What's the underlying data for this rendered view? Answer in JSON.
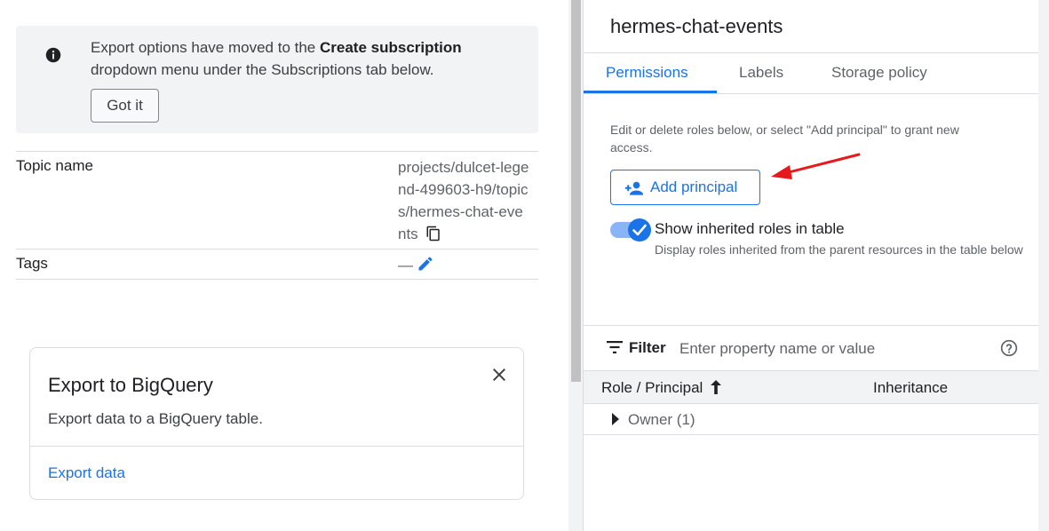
{
  "banner": {
    "text_before": "Export options have moved to the ",
    "text_bold": "Create subscription",
    "text_after": " dropdown menu under the Subscriptions tab below.",
    "button_label": "Got it",
    "icon": "info-icon"
  },
  "properties": [
    {
      "label": "Topic name",
      "value": "projects/dulcet-legend-499603-h9/topics/hermes-chat-events",
      "action_icon": "copy-icon"
    },
    {
      "label": "Tags",
      "value": "—",
      "action_icon": "edit-icon"
    }
  ],
  "export_card": {
    "title": "Export to BigQuery",
    "description": "Export data to a BigQuery table.",
    "link": "Export data",
    "close_icon": "close-icon"
  },
  "panel": {
    "title": "hermes-chat-events",
    "tabs": [
      {
        "label": "Permissions",
        "active": true
      },
      {
        "label": "Labels",
        "active": false
      },
      {
        "label": "Storage policy",
        "active": false
      }
    ],
    "description": "Edit or delete roles below, or select \"Add principal\" to grant new access.",
    "add_button": "Add principal",
    "toggle": {
      "label": "Show inherited roles in table",
      "sub": "Display roles inherited from the parent resources in the table below",
      "on": true
    },
    "filter": {
      "label": "Filter",
      "placeholder": "Enter property name or value"
    },
    "table": {
      "columns": [
        "Role / Principal",
        "Inheritance"
      ],
      "rows": [
        {
          "label": "Owner (1)"
        }
      ]
    }
  },
  "colors": {
    "accent": "#1a73e8",
    "annotation_arrow": "#e8191c"
  }
}
